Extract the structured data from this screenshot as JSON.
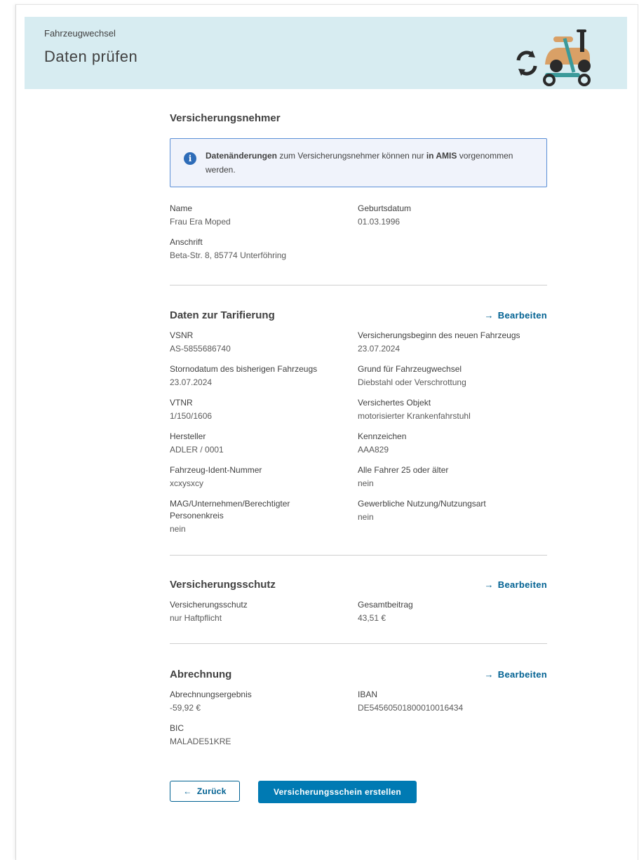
{
  "header": {
    "breadcrumb": "Fahrzeugwechsel",
    "title": "Daten prüfen"
  },
  "policyholder": {
    "title": "Versicherungsnehmer",
    "info_bold1": "Datenänderungen",
    "info_text1": " zum Versicherungsnehmer können nur ",
    "info_bold2": "in AMIS",
    "info_text2": " vorgenommen werden.",
    "fields": {
      "name_label": "Name",
      "name_value": "Frau Era Moped",
      "birth_label": "Geburtsdatum",
      "birth_value": "01.03.1996",
      "address_label": "Anschrift",
      "address_value": "Beta-Str. 8, 85774 Unterföhring"
    }
  },
  "tariff": {
    "title": "Daten zur Tarifierung",
    "edit_label": "Bearbeiten",
    "vsnr_label": "VSNR",
    "vsnr_value": "AS-5855686740",
    "start_label": "Versicherungsbeginn des neuen Fahrzeugs",
    "start_value": "23.07.2024",
    "cancel_label": "Stornodatum des bisherigen Fahrzeugs",
    "cancel_value": "23.07.2024",
    "reason_label": "Grund für Fahrzeugwechsel",
    "reason_value": "Diebstahl oder Verschrottung",
    "vtnr_label": "VTNR",
    "vtnr_value": "1/150/1606",
    "object_label": "Versichertes Objekt",
    "object_value": "motorisierter Krankenfahrstuhl",
    "maker_label": "Hersteller",
    "maker_value": "ADLER / 0001",
    "plate_label": "Kennzeichen",
    "plate_value": "AAA829",
    "vin_label": "Fahrzeug-Ident-Nummer",
    "vin_value": "xcxysxcy",
    "drivers_label": "Alle Fahrer 25 oder älter",
    "drivers_value": "nein",
    "mag_label": "MAG/Unternehmen/Berechtigter Personenkreis",
    "mag_value": "nein",
    "commercial_label": "Gewerbliche Nutzung/Nutzungsart",
    "commercial_value": "nein"
  },
  "coverage": {
    "title": "Versicherungsschutz",
    "edit_label": "Bearbeiten",
    "cover_label": "Versicherungsschutz",
    "cover_value": "nur Haftpflicht",
    "total_label": "Gesamtbeitrag",
    "total_value": "43,51 €"
  },
  "billing": {
    "title": "Abrechnung",
    "edit_label": "Bearbeiten",
    "result_label": "Abrechnungsergebnis",
    "result_value": "-59,92 €",
    "iban_label": "IBAN",
    "iban_value": "DE54560501800010016434",
    "bic_label": "BIC",
    "bic_value": "MALADE51KRE"
  },
  "actions": {
    "back_label": "Zurück",
    "back_arrow": "←",
    "submit_label": "Versicherungsschein erstellen"
  },
  "colors": {
    "accent": "#006192",
    "primary_button": "#007ab3",
    "header_bg": "#d7ecf1",
    "info_border": "#5b8fd6",
    "illustration_orange": "#d9a066",
    "illustration_teal": "#3b9a9a"
  },
  "icons": [
    "info-icon",
    "refresh-icon",
    "scooter-illustration",
    "arrow-right-icon",
    "arrow-left-icon"
  ]
}
